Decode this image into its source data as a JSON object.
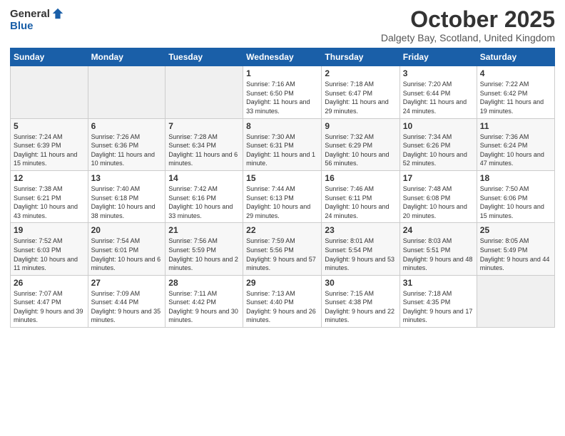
{
  "header": {
    "logo_general": "General",
    "logo_blue": "Blue",
    "month": "October 2025",
    "location": "Dalgety Bay, Scotland, United Kingdom"
  },
  "days_of_week": [
    "Sunday",
    "Monday",
    "Tuesday",
    "Wednesday",
    "Thursday",
    "Friday",
    "Saturday"
  ],
  "weeks": [
    [
      {
        "day": "",
        "sunrise": "",
        "sunset": "",
        "daylight": ""
      },
      {
        "day": "",
        "sunrise": "",
        "sunset": "",
        "daylight": ""
      },
      {
        "day": "",
        "sunrise": "",
        "sunset": "",
        "daylight": ""
      },
      {
        "day": "1",
        "sunrise": "Sunrise: 7:16 AM",
        "sunset": "Sunset: 6:50 PM",
        "daylight": "Daylight: 11 hours and 33 minutes."
      },
      {
        "day": "2",
        "sunrise": "Sunrise: 7:18 AM",
        "sunset": "Sunset: 6:47 PM",
        "daylight": "Daylight: 11 hours and 29 minutes."
      },
      {
        "day": "3",
        "sunrise": "Sunrise: 7:20 AM",
        "sunset": "Sunset: 6:44 PM",
        "daylight": "Daylight: 11 hours and 24 minutes."
      },
      {
        "day": "4",
        "sunrise": "Sunrise: 7:22 AM",
        "sunset": "Sunset: 6:42 PM",
        "daylight": "Daylight: 11 hours and 19 minutes."
      }
    ],
    [
      {
        "day": "5",
        "sunrise": "Sunrise: 7:24 AM",
        "sunset": "Sunset: 6:39 PM",
        "daylight": "Daylight: 11 hours and 15 minutes."
      },
      {
        "day": "6",
        "sunrise": "Sunrise: 7:26 AM",
        "sunset": "Sunset: 6:36 PM",
        "daylight": "Daylight: 11 hours and 10 minutes."
      },
      {
        "day": "7",
        "sunrise": "Sunrise: 7:28 AM",
        "sunset": "Sunset: 6:34 PM",
        "daylight": "Daylight: 11 hours and 6 minutes."
      },
      {
        "day": "8",
        "sunrise": "Sunrise: 7:30 AM",
        "sunset": "Sunset: 6:31 PM",
        "daylight": "Daylight: 11 hours and 1 minute."
      },
      {
        "day": "9",
        "sunrise": "Sunrise: 7:32 AM",
        "sunset": "Sunset: 6:29 PM",
        "daylight": "Daylight: 10 hours and 56 minutes."
      },
      {
        "day": "10",
        "sunrise": "Sunrise: 7:34 AM",
        "sunset": "Sunset: 6:26 PM",
        "daylight": "Daylight: 10 hours and 52 minutes."
      },
      {
        "day": "11",
        "sunrise": "Sunrise: 7:36 AM",
        "sunset": "Sunset: 6:24 PM",
        "daylight": "Daylight: 10 hours and 47 minutes."
      }
    ],
    [
      {
        "day": "12",
        "sunrise": "Sunrise: 7:38 AM",
        "sunset": "Sunset: 6:21 PM",
        "daylight": "Daylight: 10 hours and 43 minutes."
      },
      {
        "day": "13",
        "sunrise": "Sunrise: 7:40 AM",
        "sunset": "Sunset: 6:18 PM",
        "daylight": "Daylight: 10 hours and 38 minutes."
      },
      {
        "day": "14",
        "sunrise": "Sunrise: 7:42 AM",
        "sunset": "Sunset: 6:16 PM",
        "daylight": "Daylight: 10 hours and 33 minutes."
      },
      {
        "day": "15",
        "sunrise": "Sunrise: 7:44 AM",
        "sunset": "Sunset: 6:13 PM",
        "daylight": "Daylight: 10 hours and 29 minutes."
      },
      {
        "day": "16",
        "sunrise": "Sunrise: 7:46 AM",
        "sunset": "Sunset: 6:11 PM",
        "daylight": "Daylight: 10 hours and 24 minutes."
      },
      {
        "day": "17",
        "sunrise": "Sunrise: 7:48 AM",
        "sunset": "Sunset: 6:08 PM",
        "daylight": "Daylight: 10 hours and 20 minutes."
      },
      {
        "day": "18",
        "sunrise": "Sunrise: 7:50 AM",
        "sunset": "Sunset: 6:06 PM",
        "daylight": "Daylight: 10 hours and 15 minutes."
      }
    ],
    [
      {
        "day": "19",
        "sunrise": "Sunrise: 7:52 AM",
        "sunset": "Sunset: 6:03 PM",
        "daylight": "Daylight: 10 hours and 11 minutes."
      },
      {
        "day": "20",
        "sunrise": "Sunrise: 7:54 AM",
        "sunset": "Sunset: 6:01 PM",
        "daylight": "Daylight: 10 hours and 6 minutes."
      },
      {
        "day": "21",
        "sunrise": "Sunrise: 7:56 AM",
        "sunset": "Sunset: 5:59 PM",
        "daylight": "Daylight: 10 hours and 2 minutes."
      },
      {
        "day": "22",
        "sunrise": "Sunrise: 7:59 AM",
        "sunset": "Sunset: 5:56 PM",
        "daylight": "Daylight: 9 hours and 57 minutes."
      },
      {
        "day": "23",
        "sunrise": "Sunrise: 8:01 AM",
        "sunset": "Sunset: 5:54 PM",
        "daylight": "Daylight: 9 hours and 53 minutes."
      },
      {
        "day": "24",
        "sunrise": "Sunrise: 8:03 AM",
        "sunset": "Sunset: 5:51 PM",
        "daylight": "Daylight: 9 hours and 48 minutes."
      },
      {
        "day": "25",
        "sunrise": "Sunrise: 8:05 AM",
        "sunset": "Sunset: 5:49 PM",
        "daylight": "Daylight: 9 hours and 44 minutes."
      }
    ],
    [
      {
        "day": "26",
        "sunrise": "Sunrise: 7:07 AM",
        "sunset": "Sunset: 4:47 PM",
        "daylight": "Daylight: 9 hours and 39 minutes."
      },
      {
        "day": "27",
        "sunrise": "Sunrise: 7:09 AM",
        "sunset": "Sunset: 4:44 PM",
        "daylight": "Daylight: 9 hours and 35 minutes."
      },
      {
        "day": "28",
        "sunrise": "Sunrise: 7:11 AM",
        "sunset": "Sunset: 4:42 PM",
        "daylight": "Daylight: 9 hours and 30 minutes."
      },
      {
        "day": "29",
        "sunrise": "Sunrise: 7:13 AM",
        "sunset": "Sunset: 4:40 PM",
        "daylight": "Daylight: 9 hours and 26 minutes."
      },
      {
        "day": "30",
        "sunrise": "Sunrise: 7:15 AM",
        "sunset": "Sunset: 4:38 PM",
        "daylight": "Daylight: 9 hours and 22 minutes."
      },
      {
        "day": "31",
        "sunrise": "Sunrise: 7:18 AM",
        "sunset": "Sunset: 4:35 PM",
        "daylight": "Daylight: 9 hours and 17 minutes."
      },
      {
        "day": "",
        "sunrise": "",
        "sunset": "",
        "daylight": ""
      }
    ]
  ]
}
